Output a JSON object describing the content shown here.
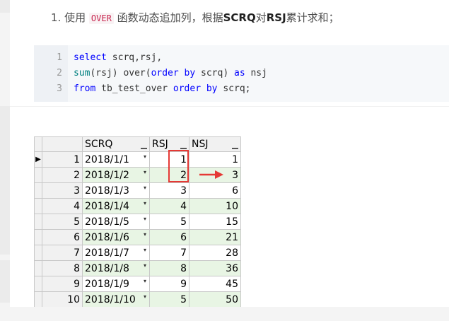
{
  "step": {
    "number": "1.",
    "text_before": "使用",
    "keyword": "OVER",
    "text_middle": "函数动态追加列，根据",
    "bold1": "SCRQ",
    "text_mid2": "对",
    "bold2": "RSJ",
    "text_after": "累计求和；"
  },
  "code": {
    "lines": [
      {
        "num": "1",
        "parts": [
          "select",
          " scrq,rsj,"
        ]
      },
      {
        "num": "2",
        "parts": [
          "sum",
          "(rsj) over(",
          "order by",
          " scrq) ",
          "as",
          " nsj"
        ]
      },
      {
        "num": "3",
        "parts": [
          "from",
          " tb_test_over ",
          "order by",
          " scrq;"
        ]
      }
    ]
  },
  "grid": {
    "headers": [
      "SCRQ",
      "RSJ",
      "NSJ"
    ],
    "current_row_marker": "▶",
    "dropdown_glyph": "▾",
    "rows": [
      {
        "rn": "1",
        "scrq": "2018/1/1",
        "rsj": "1",
        "nsj": "1"
      },
      {
        "rn": "2",
        "scrq": "2018/1/2",
        "rsj": "2",
        "nsj": "3"
      },
      {
        "rn": "3",
        "scrq": "2018/1/3",
        "rsj": "3",
        "nsj": "6"
      },
      {
        "rn": "4",
        "scrq": "2018/1/4",
        "rsj": "4",
        "nsj": "10"
      },
      {
        "rn": "5",
        "scrq": "2018/1/5",
        "rsj": "5",
        "nsj": "15"
      },
      {
        "rn": "6",
        "scrq": "2018/1/6",
        "rsj": "6",
        "nsj": "21"
      },
      {
        "rn": "7",
        "scrq": "2018/1/7",
        "rsj": "7",
        "nsj": "28"
      },
      {
        "rn": "8",
        "scrq": "2018/1/8",
        "rsj": "8",
        "nsj": "36"
      },
      {
        "rn": "9",
        "scrq": "2018/1/9",
        "rsj": "9",
        "nsj": "45"
      },
      {
        "rn": "10",
        "scrq": "2018/1/10",
        "rsj": "5",
        "nsj": "50"
      }
    ]
  },
  "colors": {
    "annotation": "#e53935",
    "alt_row": "#e8f5e4",
    "keyword_blue": "#0000ff",
    "function_teal": "#008080"
  }
}
